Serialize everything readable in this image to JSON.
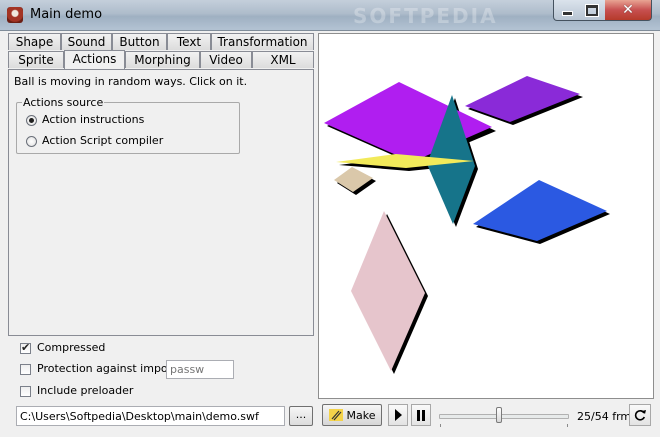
{
  "window": {
    "title": "Main demo",
    "watermark": "SOFTPEDIA"
  },
  "tabs": {
    "row1": [
      {
        "label": "Shape"
      },
      {
        "label": "Sound"
      },
      {
        "label": "Button"
      },
      {
        "label": "Text"
      },
      {
        "label": "Transformation"
      }
    ],
    "row2": [
      {
        "label": "Sprite"
      },
      {
        "label": "Actions"
      },
      {
        "label": "Morphing"
      },
      {
        "label": "Video"
      },
      {
        "label": "XML"
      }
    ],
    "active": "Actions"
  },
  "actions_panel": {
    "description": "Ball is moving in random ways. Click on it.",
    "source_group_label": "Actions source",
    "options": [
      {
        "label": "Action instructions",
        "selected": true
      },
      {
        "label": "Action Script compiler",
        "selected": false
      }
    ]
  },
  "options": {
    "compressed": {
      "label": "Compressed",
      "checked": true
    },
    "protection": {
      "label": "Protection against import",
      "checked": false,
      "password_placeholder": "passw"
    },
    "preloader": {
      "label": "Include preloader",
      "checked": false
    }
  },
  "output_path": "C:\\Users\\Softpedia\\Desktop\\main\\demo.swf",
  "browse_label": "...",
  "player": {
    "make_label": "Make",
    "current_frame": 25,
    "total_frames": 54,
    "frame_text": "25/54 frm"
  },
  "shapes": {
    "colors": {
      "purple_large": "#b01ef0",
      "purple_small": "#8a2ad8",
      "teal": "#16748a",
      "yellow": "#f2ea5a",
      "tan": "#dac8aa",
      "blue": "#2b59e2",
      "pink": "#e6c5cc"
    }
  }
}
